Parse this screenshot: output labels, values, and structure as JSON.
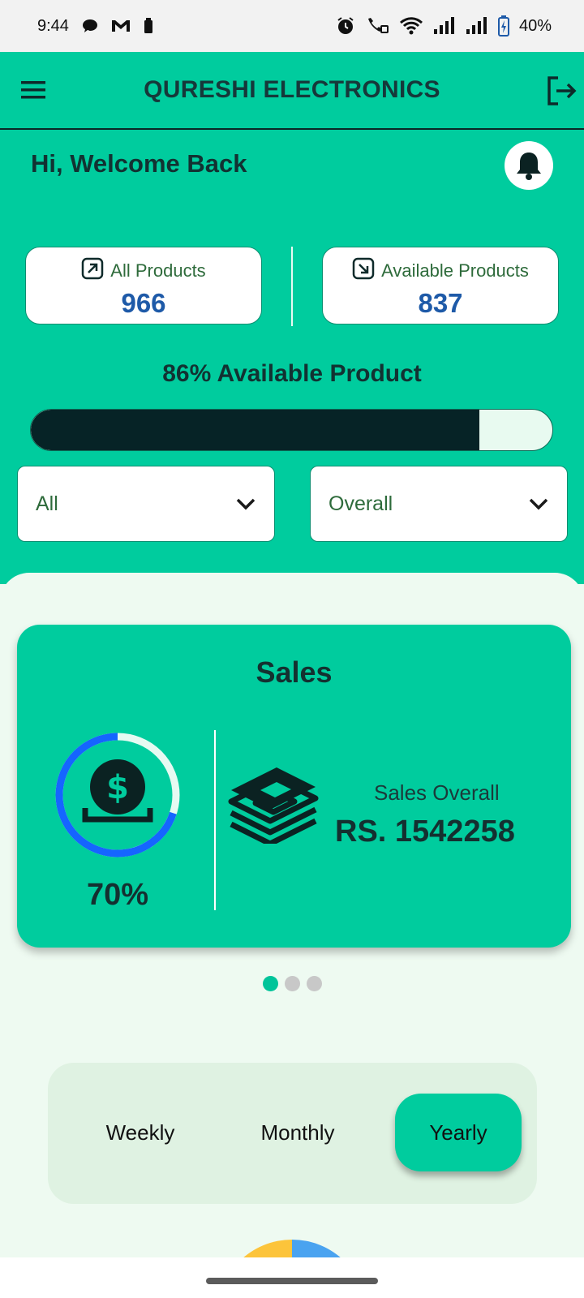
{
  "status_bar": {
    "time": "9:44",
    "battery": "40%",
    "icons": [
      "chat-bubble-icon",
      "gmail-icon",
      "battery-small-icon",
      "alarm-icon",
      "wifi-call-icon",
      "wifi-icon",
      "signal-icon",
      "signal-icon",
      "battery-charging-icon"
    ]
  },
  "app_bar": {
    "title": "QURESHI ELECTRONICS",
    "menu_icon": "hamburger-menu-icon",
    "logout_icon": "logout-icon"
  },
  "header": {
    "welcome": "Hi, Welcome Back",
    "notification_icon": "bell-icon"
  },
  "stats": {
    "all_products": {
      "label": "All Products",
      "value": "966",
      "icon": "arrow-up-right-icon"
    },
    "available_products": {
      "label": "Available Products",
      "value": "837",
      "icon": "arrow-down-right-icon"
    }
  },
  "availability": {
    "text": "86% Available Product",
    "fraction": 0.86
  },
  "filters": {
    "category": {
      "selected": "All"
    },
    "period": {
      "selected": "Overall"
    }
  },
  "sales_card": {
    "title": "Sales",
    "percent": "70%",
    "percent_value": 0.7,
    "overall_label": "Sales Overall",
    "overall_value": "RS. 1542258",
    "icon_ring": "dollar-coin-icon",
    "icon_money": "cash-stack-icon"
  },
  "carousel": {
    "pages": 3,
    "active": 0
  },
  "period_tabs": {
    "options": [
      "Weekly",
      "Monthly",
      "Yearly"
    ],
    "active": 2
  },
  "colors": {
    "primary": "#00cc9e",
    "dark": "#062326",
    "value_blue": "#1e5aa8",
    "ring_blue": "#1565ff",
    "text_green": "#2e6b3b",
    "pie_yellow": "#fcc43b",
    "pie_blue": "#4aa3f0"
  }
}
